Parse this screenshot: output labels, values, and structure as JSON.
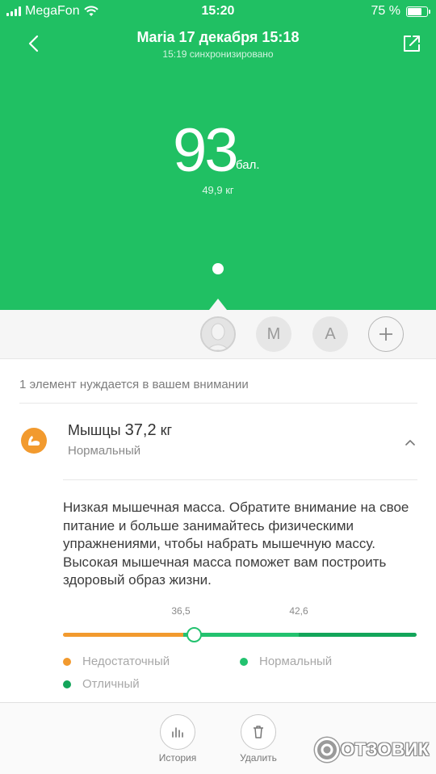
{
  "status_bar": {
    "carrier": "MegaFon",
    "time": "15:20",
    "battery": "75 %",
    "battery_level": 0.75
  },
  "header": {
    "title": "Maria 17 декабря 15:18",
    "subtitle": "15:19 синхронизировано"
  },
  "summary": {
    "score": "93",
    "score_unit": "бал.",
    "weight": "49,9 кг"
  },
  "users": {
    "items": [
      {
        "label": "M"
      },
      {
        "label": "A"
      }
    ]
  },
  "attention_text": "1 элемент нуждается в вашем внимании",
  "metric": {
    "name": "Мышцы",
    "value": "37,2",
    "unit": "кг",
    "status": "Нормальный",
    "description": "Низкая мышечная масса. Обратите внимание на свое питание и больше занимайтесь физическими упражнениями, чтобы набрать мышечную массу. Высокая мышечная масса поможет вам построить здоровый образ жизни.",
    "range": {
      "tick_low": "36,5",
      "tick_high": "42,6",
      "current_value": 37.2
    },
    "legend": [
      {
        "label": "Недостаточный",
        "color": "#f29a2e"
      },
      {
        "label": "Нормальный",
        "color": "#23c26f"
      },
      {
        "label": "Отличный",
        "color": "#13a55a"
      }
    ]
  },
  "bottom_bar": {
    "history_label": "История",
    "delete_label": "Удалить"
  },
  "watermark": {
    "text": "ОТЗОВИК"
  },
  "colors": {
    "accent_green": "#20c063",
    "muscle_orange": "#f29a2e"
  },
  "icons": {
    "back": "chevron-left-icon",
    "share": "share-icon",
    "muscle": "muscle-arm-icon",
    "collapse": "chevron-up-icon",
    "history": "bar-chart-icon",
    "delete": "trash-icon",
    "add_user": "plus-icon"
  }
}
